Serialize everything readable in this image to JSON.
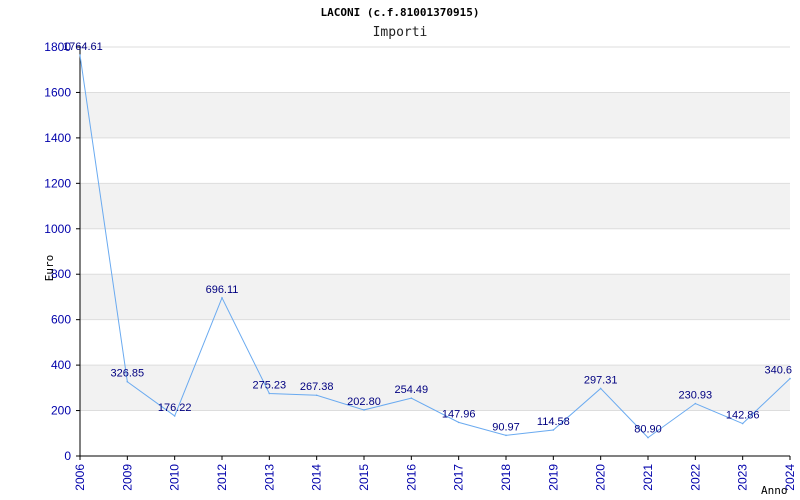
{
  "chart_data": {
    "type": "line",
    "title": "LACONI (c.f.81001370915)",
    "subtitle": "Importi",
    "xlabel": "Anno",
    "ylabel": "Euro",
    "ylim": [
      0,
      1800
    ],
    "yticks": [
      0,
      200,
      400,
      600,
      800,
      1000,
      1200,
      1400,
      1600,
      1800
    ],
    "grid": "horizontal bands",
    "categories": [
      "2006",
      "2009",
      "2010",
      "2012",
      "2013",
      "2014",
      "2015",
      "2016",
      "2017",
      "2018",
      "2019",
      "2020",
      "2021",
      "2022",
      "2023",
      "2024"
    ],
    "values": [
      1764.61,
      326.85,
      176.22,
      696.11,
      275.23,
      267.38,
      202.8,
      254.49,
      147.96,
      90.97,
      114.58,
      297.31,
      80.9,
      230.93,
      142.86,
      340.6
    ],
    "labels": [
      "1764.61",
      "326.85",
      "176.22",
      "696.11",
      "275.23",
      "267.38",
      "202.80",
      "254.49",
      "147.96",
      "90.97",
      "114.58",
      "297.31",
      "80.90",
      "230.93",
      "142.86",
      "340.6"
    ],
    "colors": {
      "line": "#6aaaf0",
      "band": "#f2f2f2",
      "grid": "#dddddd",
      "tick_text": "#0000aa",
      "label_text": "#000080"
    }
  }
}
